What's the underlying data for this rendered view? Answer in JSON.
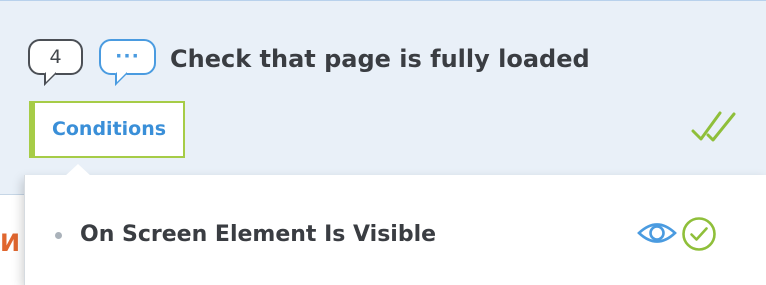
{
  "step": {
    "number": "4",
    "comment_icon": "speech-bubble-ellipsis",
    "comment_text": "···",
    "title": "Check that page is fully loaded",
    "conditions_tab_label": "Conditions",
    "status_icon": "double-check"
  },
  "conditions_popup": {
    "items": [
      {
        "label": "On Screen Element Is Visible",
        "icons": [
          "eye-icon",
          "check-circle-icon"
        ]
      }
    ]
  },
  "background_fragment": "И",
  "colors": {
    "card_background": "#e9f0f8",
    "accent_blue": "#4a9be0",
    "accent_green": "#a6cc47",
    "text_dark": "#3a3d42",
    "fragment_orange": "#e0662e"
  }
}
